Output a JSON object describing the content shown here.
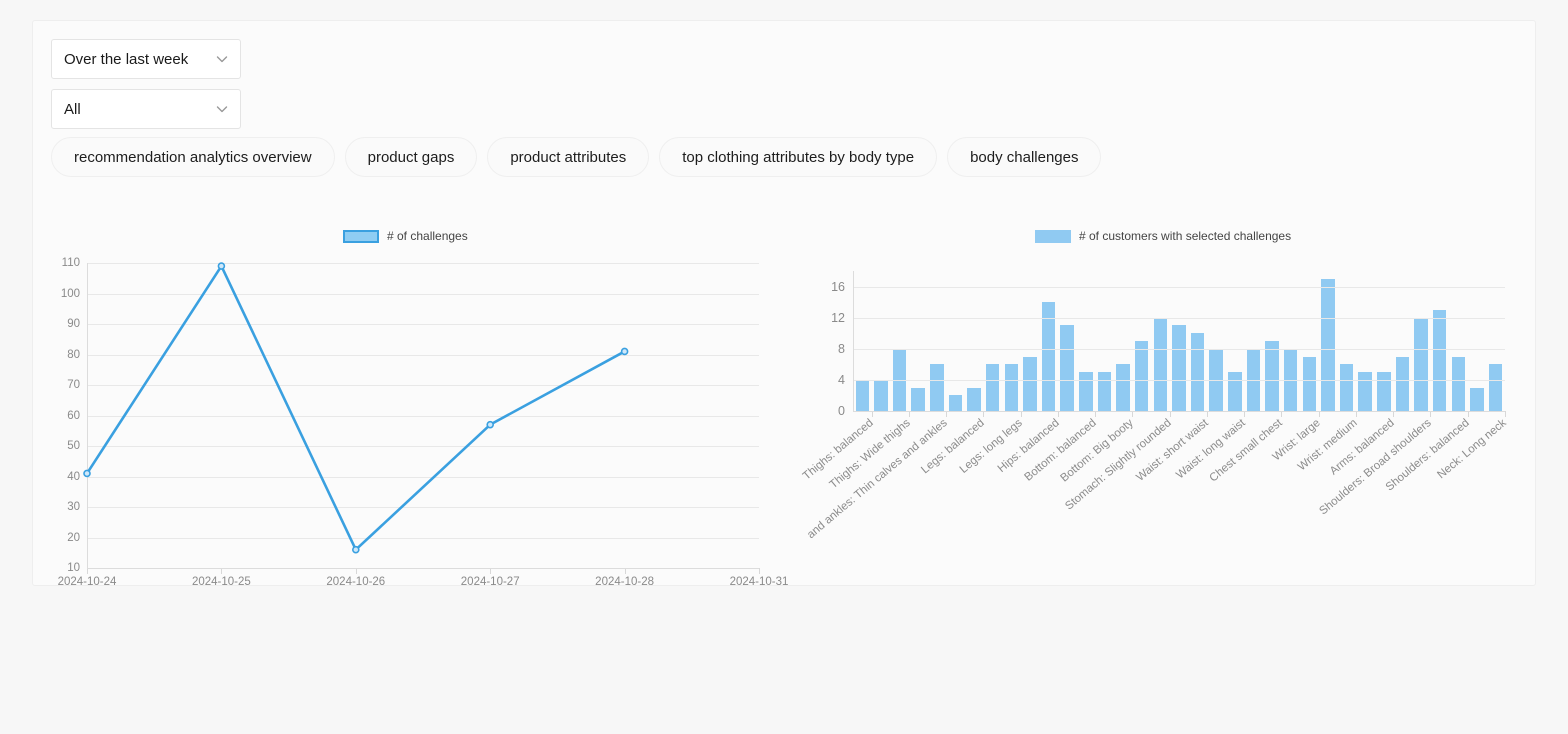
{
  "filters": {
    "range": {
      "value": "Over the last week",
      "icon": "chevron-down-icon"
    },
    "scope": {
      "value": "All",
      "icon": "chevron-down-icon"
    }
  },
  "tabs": [
    {
      "label": "recommendation analytics overview"
    },
    {
      "label": "product gaps"
    },
    {
      "label": "product attributes"
    },
    {
      "label": "top clothing attributes by body type"
    },
    {
      "label": "body challenges"
    }
  ],
  "colors": {
    "series_line": "#3aa0e0",
    "series_line_fill": "#8fcdf3",
    "series_bar": "#90caf2",
    "grid": "#e8e8e8",
    "axis_text": "#8a8a8a",
    "card_bg": "#fbfbfb",
    "page_bg": "#f7f7f7"
  },
  "chart_data": [
    {
      "type": "line",
      "title": "",
      "legend": [
        "# of challenges"
      ],
      "legend_position": "top-center",
      "xlabel": "",
      "ylabel": "",
      "grid": true,
      "x": [
        "2024-10-24",
        "2024-10-25",
        "2024-10-26",
        "2024-10-27",
        "2024-10-28"
      ],
      "xtick_labels": [
        "2024-10-24",
        "2024-10-25",
        "2024-10-26",
        "2024-10-27",
        "2024-10-28",
        "2024-10-31"
      ],
      "ytick_labels": [
        "10",
        "20",
        "30",
        "40",
        "50",
        "60",
        "70",
        "80",
        "90",
        "100",
        "110"
      ],
      "yticks": [
        10,
        20,
        30,
        40,
        50,
        60,
        70,
        80,
        90,
        100,
        110
      ],
      "ylim": [
        10,
        110
      ],
      "series": [
        {
          "name": "# of challenges",
          "values": [
            41,
            109,
            16,
            57,
            81
          ]
        }
      ]
    },
    {
      "type": "bar",
      "title": "",
      "legend": [
        "# of customers with selected challenges"
      ],
      "legend_position": "top-center",
      "xlabel": "",
      "ylabel": "",
      "grid": true,
      "ylim": [
        0,
        18
      ],
      "yticks": [
        0,
        4,
        8,
        12,
        16
      ],
      "ytick_labels": [
        "0",
        "4",
        "8",
        "12",
        "16"
      ],
      "xtick_labels": [
        "Thighs: balanced",
        "Thighs: Wide thighs",
        "and ankles: Thin calves and ankles",
        "Legs: balanced",
        "Legs: long legs",
        "Hips: balanced",
        "Bottom: balanced",
        "Bottom: Big booty",
        "Stomach: Slightly rounded",
        "Waist: short waist",
        "Waist: long waist",
        "Chest small chest",
        "Wrist: large",
        "Wrist: medium",
        "Arms: balanced",
        "Shoulders: Broad shoulders",
        "Shoulders: balanced",
        "Neck: Long neck"
      ],
      "series": [
        {
          "name": "# of customers with selected challenges",
          "values": [
            4,
            4,
            8,
            3,
            6,
            2,
            3,
            6,
            6,
            7,
            14,
            11,
            5,
            5,
            6,
            9,
            12,
            11,
            10,
            8,
            5,
            8,
            9,
            8,
            7,
            17,
            6,
            5,
            5,
            7,
            12,
            13,
            7,
            3,
            6
          ]
        }
      ]
    }
  ]
}
